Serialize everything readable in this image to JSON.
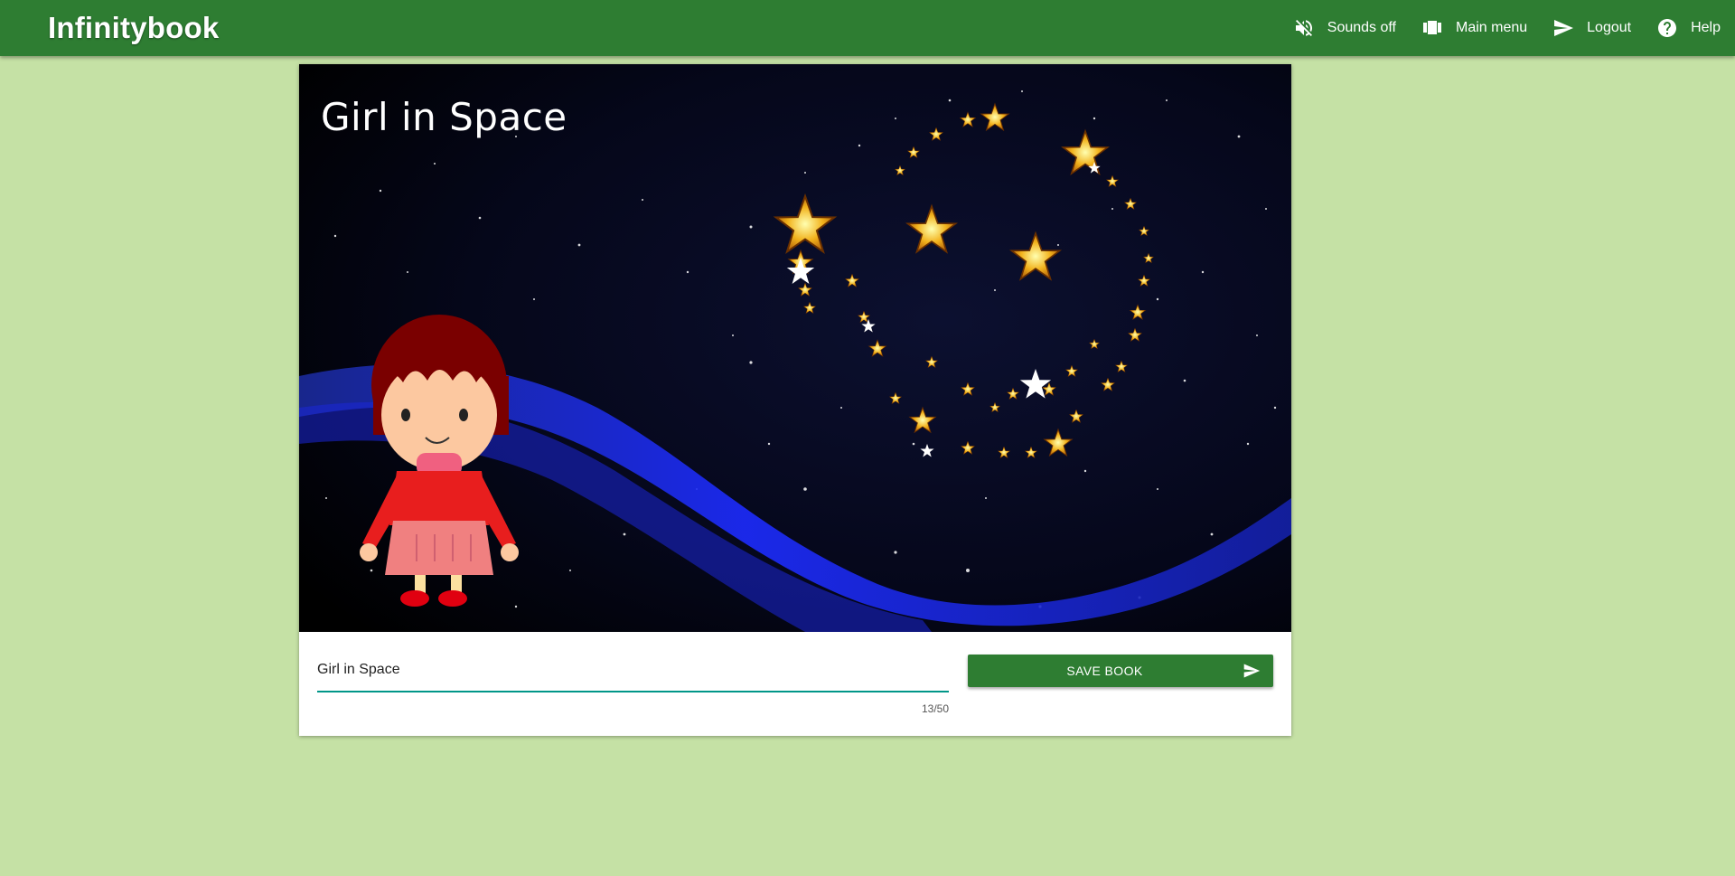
{
  "app": {
    "brand": "Infinitybook"
  },
  "nav": {
    "sounds_label": "Sounds off",
    "sounds_icon": "volume-off-icon",
    "main_menu_label": "Main menu",
    "main_menu_icon": "view-carousel-icon",
    "logout_label": "Logout",
    "logout_icon": "send-icon",
    "help_label": "Help",
    "help_icon": "help-circle-icon"
  },
  "book": {
    "cover_title": "Girl in Space",
    "title_value": "Girl in Space",
    "char_counter": "13/50",
    "save_label": "SAVE BOOK",
    "save_icon": "send-icon"
  },
  "colors": {
    "header": "#2e7d32",
    "page_background": "#c5e1a5",
    "input_underline": "#009688",
    "save_button": "#2e7d32"
  }
}
